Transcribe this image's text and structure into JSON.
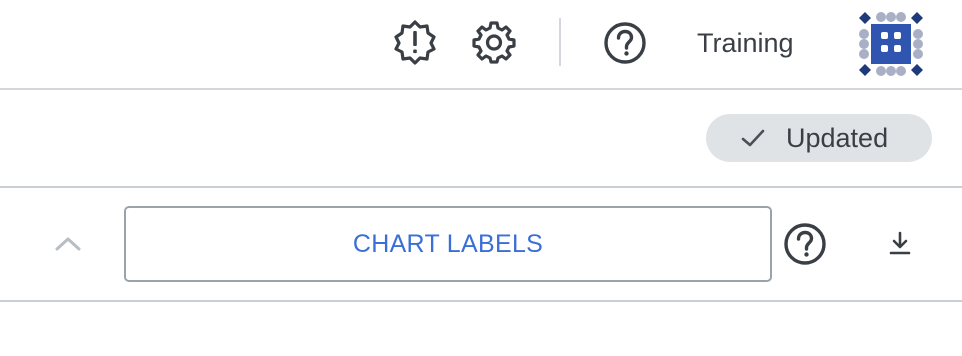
{
  "header": {
    "alert_icon": "alert-badge-icon",
    "settings_icon": "gear-icon",
    "help_icon": "help-circle-icon",
    "training_label": "Training",
    "logo": "app-logo"
  },
  "status": {
    "label": "Updated",
    "icon": "check-icon"
  },
  "chart_section": {
    "collapse_icon": "chevron-up-icon",
    "button_label": "CHART LABELS",
    "help_icon": "help-circle-icon",
    "download_icon": "download-icon"
  },
  "colors": {
    "text": "#3a3f45",
    "accent": "#3a6fd8",
    "logo_primary": "#2f55b0",
    "logo_dark": "#1f3a7a",
    "logo_light": "#a9b0c6",
    "badge_bg": "#dfe3e6"
  }
}
